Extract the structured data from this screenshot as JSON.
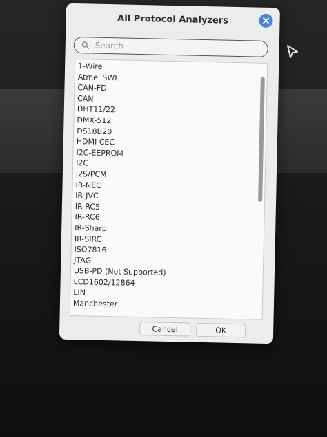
{
  "dialog": {
    "title": "All Protocol Analyzers",
    "close_icon": "close-icon",
    "accent_color": "#4a86d6"
  },
  "search": {
    "placeholder": "Search",
    "value": "",
    "icon": "search-icon"
  },
  "list": {
    "items": [
      "1-Wire",
      "Atmel SWI",
      "CAN-FD",
      "CAN",
      "DHT11/22",
      "DMX-512",
      "DS18B20",
      "HDMI CEC",
      "I2C-EEPROM",
      "I2C",
      "I2S/PCM",
      "IR-NEC",
      "IR-JVC",
      "IR-RC5",
      "IR-RC6",
      "IR-Sharp",
      "IR-SIRC",
      "ISO7816",
      "JTAG",
      "USB-PD (Not Supported)",
      "LCD1602/12864",
      "LIN",
      "Manchester"
    ]
  },
  "buttons": {
    "cancel": "Cancel",
    "ok": "OK"
  }
}
